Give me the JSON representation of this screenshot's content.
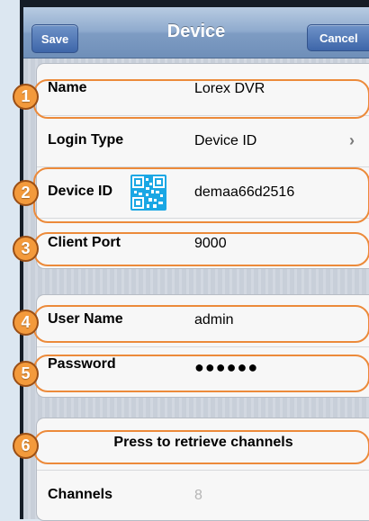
{
  "nav": {
    "save_label": "Save",
    "title": "Device",
    "cancel_label": "Cancel"
  },
  "device_section": {
    "name": {
      "label": "Name",
      "value": "Lorex DVR"
    },
    "login_type": {
      "label": "Login Type",
      "value": "Device ID",
      "icon": "chevron-right-icon"
    },
    "device_id": {
      "label": "Device ID",
      "value": "demaa66d2516",
      "icon": "qr-code-icon"
    },
    "client_port": {
      "label": "Client Port",
      "value": "9000"
    }
  },
  "credentials_section": {
    "user_name": {
      "label": "User Name",
      "value": "admin"
    },
    "password": {
      "label": "Password",
      "value": "●●●●●●"
    }
  },
  "channels_section": {
    "retrieve_label": "Press to retrieve channels",
    "channels": {
      "label": "Channels",
      "value": "8"
    }
  },
  "callouts": [
    "1",
    "2",
    "3",
    "4",
    "5",
    "6"
  ],
  "colors": {
    "callout_fill": "#f39a3c",
    "callout_border": "#ec8a3a",
    "nav_button": "#3e66a9",
    "qr_code": "#1aa7e4"
  }
}
